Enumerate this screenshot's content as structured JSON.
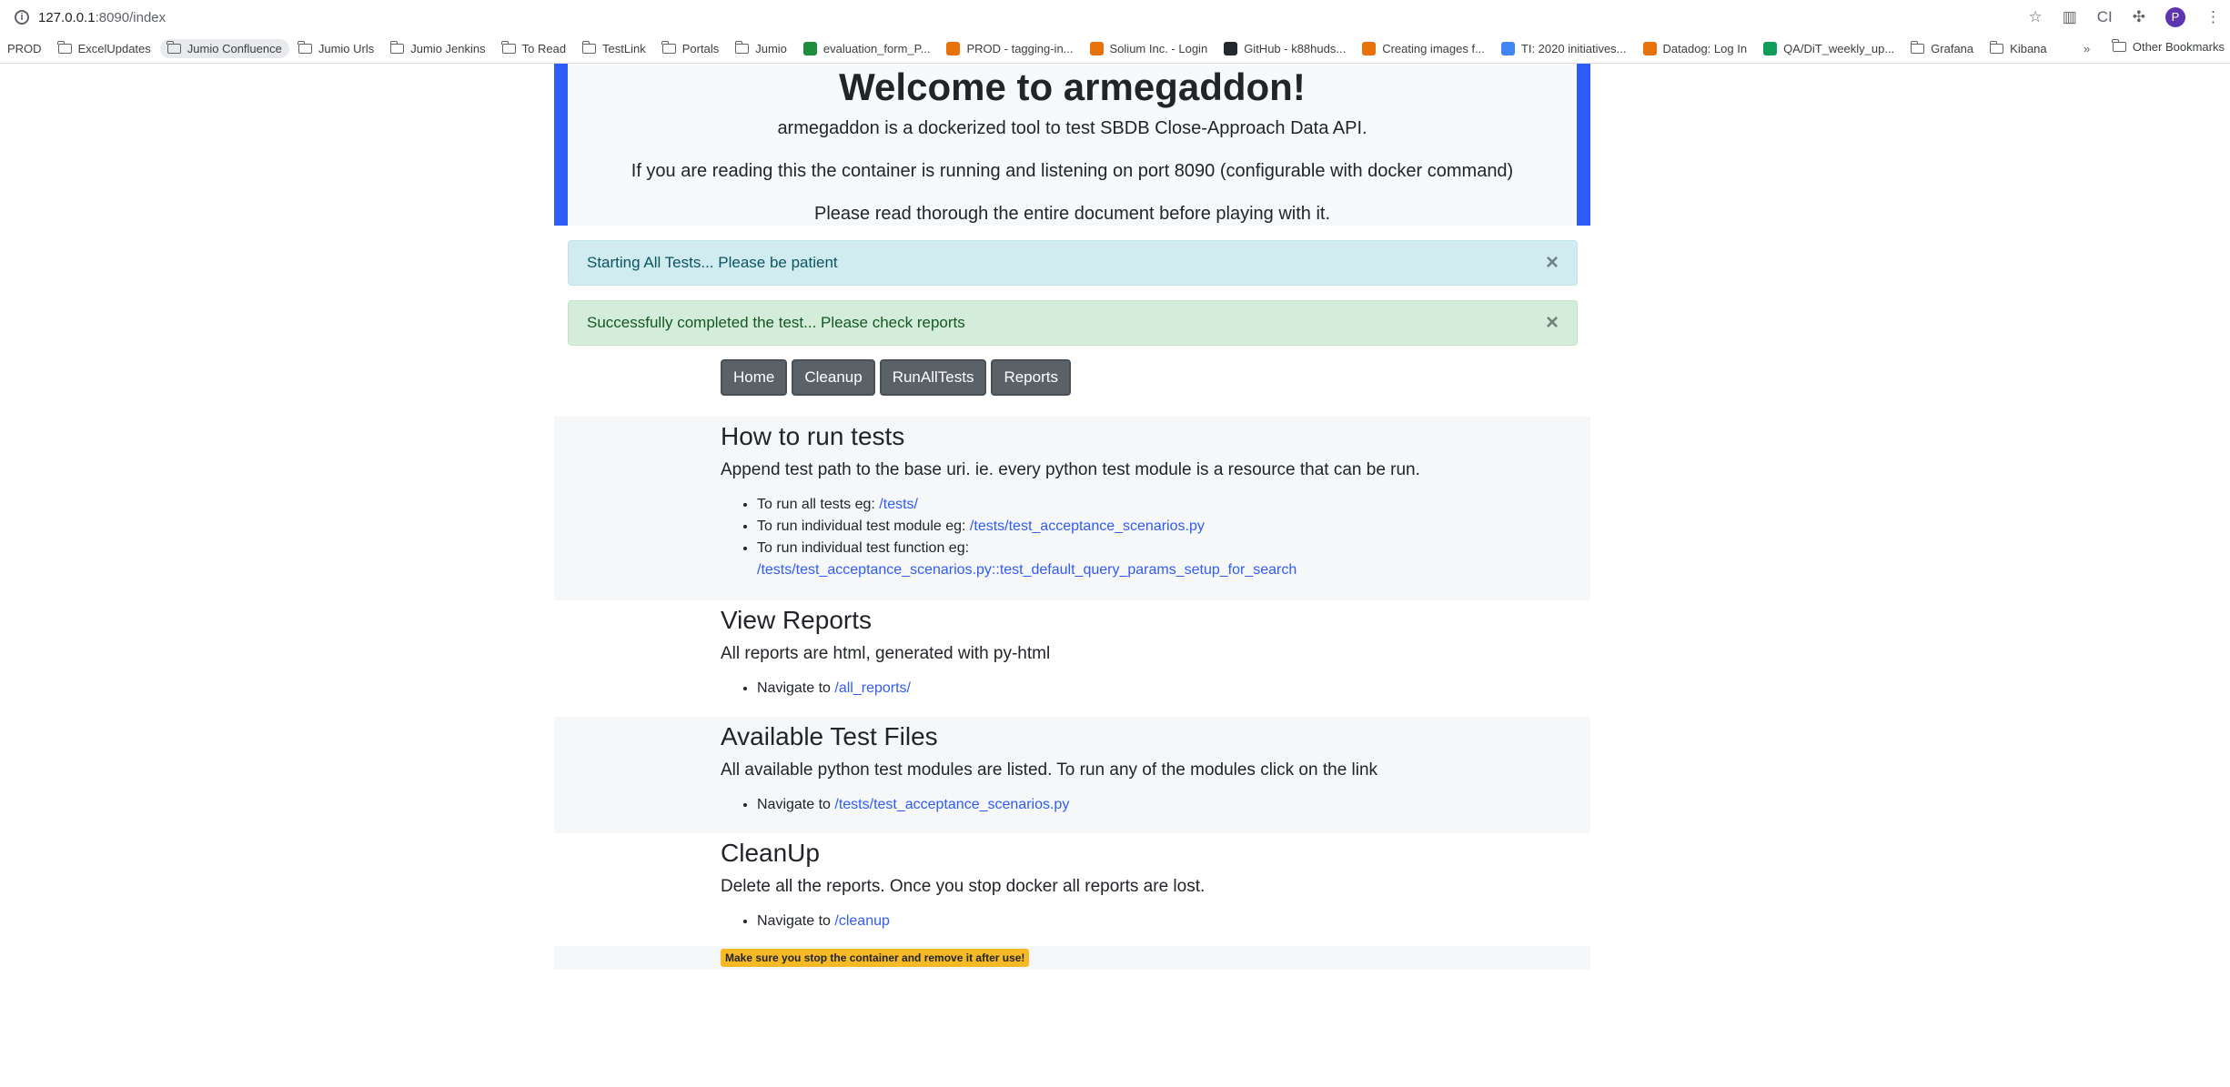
{
  "browser": {
    "url_host": "127.0.0.1",
    "url_path": ":8090/index",
    "bookmarks": [
      {
        "label": "PROD",
        "kind": "plain"
      },
      {
        "label": "ExcelUpdates",
        "kind": "folder"
      },
      {
        "label": "Jumio Confluence",
        "kind": "folder"
      },
      {
        "label": "Jumio Urls",
        "kind": "folder"
      },
      {
        "label": "Jumio Jenkins",
        "kind": "folder"
      },
      {
        "label": "To Read",
        "kind": "folder"
      },
      {
        "label": "TestLink",
        "kind": "folder"
      },
      {
        "label": "Portals",
        "kind": "folder"
      },
      {
        "label": "Jumio",
        "kind": "folder"
      },
      {
        "label": "evaluation_form_P...",
        "kind": "drive"
      },
      {
        "label": "PROD - tagging-in...",
        "kind": "site"
      },
      {
        "label": "Solium Inc. - Login",
        "kind": "site"
      },
      {
        "label": "GitHub - k88huds...",
        "kind": "github"
      },
      {
        "label": "Creating images f...",
        "kind": "site"
      },
      {
        "label": "TI: 2020 initiatives...",
        "kind": "doc"
      },
      {
        "label": "Datadog: Log In",
        "kind": "site"
      },
      {
        "label": "QA/DiT_weekly_up...",
        "kind": "sheet"
      },
      {
        "label": "Grafana",
        "kind": "folder"
      },
      {
        "label": "Kibana",
        "kind": "folder"
      }
    ],
    "other_bookmarks": "Other Bookmarks",
    "profile_initial": "P"
  },
  "hero": {
    "title": "Welcome to armegaddon!",
    "line1": "armegaddon is a dockerized tool to test SBDB Close-Approach Data API.",
    "line2": "If you are reading this the container is running and listening on port 8090 (configurable with docker command)",
    "line3": "Please read thorough the entire document before playing with it."
  },
  "alerts": {
    "info": "Starting All Tests... Please be patient",
    "success": "Successfully completed the test... Please check reports",
    "close": "×"
  },
  "nav": {
    "home": "Home",
    "cleanup": "Cleanup",
    "run_all": "RunAllTests",
    "reports": "Reports"
  },
  "howto": {
    "title": "How to run tests",
    "lead": "Append test path to the base uri. ie. every python test module is a resource that can be run.",
    "item1_text": "To run all tests eg: ",
    "item1_link": "/tests/",
    "item2_text": "To run individual test module eg: ",
    "item2_link": "/tests/test_acceptance_scenarios.py",
    "item3_text": "To run individual test function eg:",
    "item3_link": "/tests/test_acceptance_scenarios.py::test_default_query_params_setup_for_search"
  },
  "reports": {
    "title": "View Reports",
    "lead": "All reports are html, generated with py-html",
    "item_text": "Navigate to ",
    "item_link": "/all_reports/"
  },
  "files": {
    "title": "Available Test Files",
    "lead": "All available python test modules are listed. To run any of the modules click on the link",
    "item_text": "Navigate to ",
    "item_link": "/tests/test_acceptance_scenarios.py"
  },
  "cleanup": {
    "title": "CleanUp",
    "lead": "Delete all the reports. Once you stop docker all reports are lost.",
    "item_text": "Navigate to ",
    "item_link": "/cleanup"
  },
  "warning": "Make sure you stop the container and remove it after use!"
}
